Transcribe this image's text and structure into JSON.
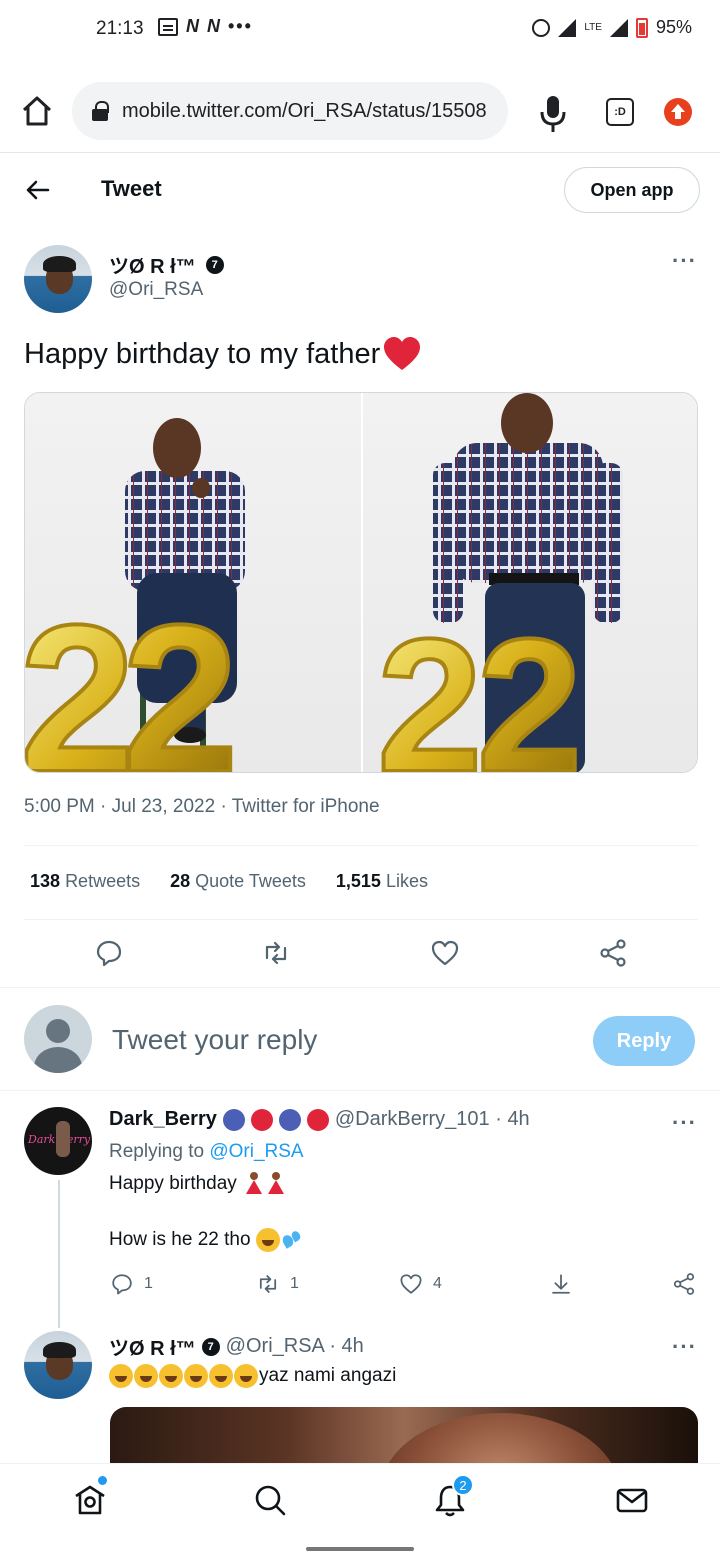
{
  "status_bar": {
    "time": "21:13",
    "left_icons": [
      "N",
      "N"
    ],
    "more": "•••",
    "network": "LTE",
    "battery": "95%"
  },
  "browser": {
    "url": "mobile.twitter.com/Ori_RSA/status/15508",
    "tab_label": ":D",
    "icons": [
      "home-icon",
      "lock-icon",
      "mic-icon",
      "tab-switcher-icon",
      "update-icon"
    ]
  },
  "header": {
    "title": "Tweet",
    "open_app": "Open app"
  },
  "tweet": {
    "display_name": "ツØ R ł™",
    "handle": "@Ori_RSA",
    "text": "Happy birthday to my father",
    "meta": "5:00 PM · Jul 23, 2022 · Twitter for iPhone",
    "retweets_count": "138",
    "retweets_label": "Retweets",
    "quotes_count": "28",
    "quotes_label": "Quote Tweets",
    "likes_count": "1,515",
    "likes_label": "Likes",
    "balloon_number": "22"
  },
  "reply_box": {
    "placeholder": "Tweet your reply",
    "button": "Reply"
  },
  "replies": [
    {
      "display_name": "Dark_Berry",
      "handle_time": "@DarkBerry_101 · 4h",
      "replying_prefix": "Replying to",
      "replying_handle": "@Ori_RSA",
      "line1": "Happy birthday",
      "line2": "How is he 22 tho",
      "avatar_text": "Dark Berry",
      "reply_count": "1",
      "retweet_count": "1",
      "like_count": "4"
    },
    {
      "display_name": "ツØ R ł™",
      "handle_time": "@Ori_RSA · 4h",
      "text": "yaz nami angazi"
    }
  ],
  "bottom_nav": {
    "notifications_badge": "2"
  },
  "colors": {
    "twitter_blue": "#1d9bf0",
    "reply_button_disabled": "#8ecdf8",
    "heart_red": "#e0243a",
    "secondary_text": "#536471"
  }
}
